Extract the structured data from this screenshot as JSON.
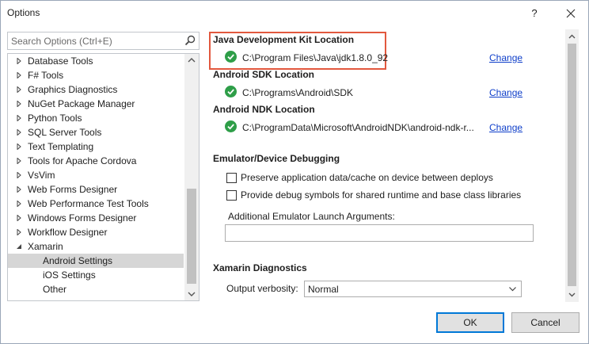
{
  "window": {
    "title": "Options"
  },
  "titlebar": {
    "help_glyph": "?",
    "close_icon": "close-icon"
  },
  "search": {
    "placeholder": "Search Options (Ctrl+E)"
  },
  "tree": {
    "items": [
      {
        "label": "Database Tools",
        "level": 0,
        "expandable": true,
        "selected": false
      },
      {
        "label": "F# Tools",
        "level": 0,
        "expandable": true,
        "selected": false
      },
      {
        "label": "Graphics Diagnostics",
        "level": 0,
        "expandable": true,
        "selected": false
      },
      {
        "label": "NuGet Package Manager",
        "level": 0,
        "expandable": true,
        "selected": false
      },
      {
        "label": "Python Tools",
        "level": 0,
        "expandable": true,
        "selected": false
      },
      {
        "label": "SQL Server Tools",
        "level": 0,
        "expandable": true,
        "selected": false
      },
      {
        "label": "Text Templating",
        "level": 0,
        "expandable": true,
        "selected": false
      },
      {
        "label": "Tools for Apache Cordova",
        "level": 0,
        "expandable": true,
        "selected": false
      },
      {
        "label": "VsVim",
        "level": 0,
        "expandable": true,
        "selected": false
      },
      {
        "label": "Web Forms Designer",
        "level": 0,
        "expandable": true,
        "selected": false
      },
      {
        "label": "Web Performance Test Tools",
        "level": 0,
        "expandable": true,
        "selected": false
      },
      {
        "label": "Windows Forms Designer",
        "level": 0,
        "expandable": true,
        "selected": false
      },
      {
        "label": "Workflow Designer",
        "level": 0,
        "expandable": true,
        "selected": false
      },
      {
        "label": "Xamarin",
        "level": 0,
        "expandable": true,
        "expanded": true,
        "selected": false
      },
      {
        "label": "Android Settings",
        "level": 1,
        "expandable": false,
        "selected": true
      },
      {
        "label": "iOS Settings",
        "level": 1,
        "expandable": false,
        "selected": false
      },
      {
        "label": "Other",
        "level": 1,
        "expandable": false,
        "selected": false
      }
    ]
  },
  "settings": {
    "jdk": {
      "heading": "Java Development Kit Location",
      "path": "C:\\Program Files\\Java\\jdk1.8.0_92",
      "change_label": "Change"
    },
    "sdk": {
      "heading": "Android SDK Location",
      "path": "C:\\Programs\\Android\\SDK",
      "change_label": "Change"
    },
    "ndk": {
      "heading": "Android NDK Location",
      "path": "C:\\ProgramData\\Microsoft\\AndroidNDK\\android-ndk-r...",
      "change_label": "Change"
    },
    "emulator": {
      "heading": "Emulator/Device Debugging",
      "preserve_label": "Preserve application data/cache on device between deploys",
      "preserve_checked": false,
      "debug_symbols_label": "Provide debug symbols for shared runtime and base class libraries",
      "debug_symbols_checked": false,
      "args_label": "Additional Emulator Launch Arguments:",
      "args_value": ""
    },
    "diagnostics": {
      "heading": "Xamarin Diagnostics",
      "verbosity_label": "Output verbosity:",
      "verbosity_value": "Normal"
    }
  },
  "footer": {
    "ok_label": "OK",
    "cancel_label": "Cancel"
  },
  "colors": {
    "highlight_border": "#e2583e",
    "link": "#0e3ec9",
    "ok_green": "#2e9e48",
    "selected_row": "#d6d6d6",
    "primary_border": "#0078d7"
  }
}
